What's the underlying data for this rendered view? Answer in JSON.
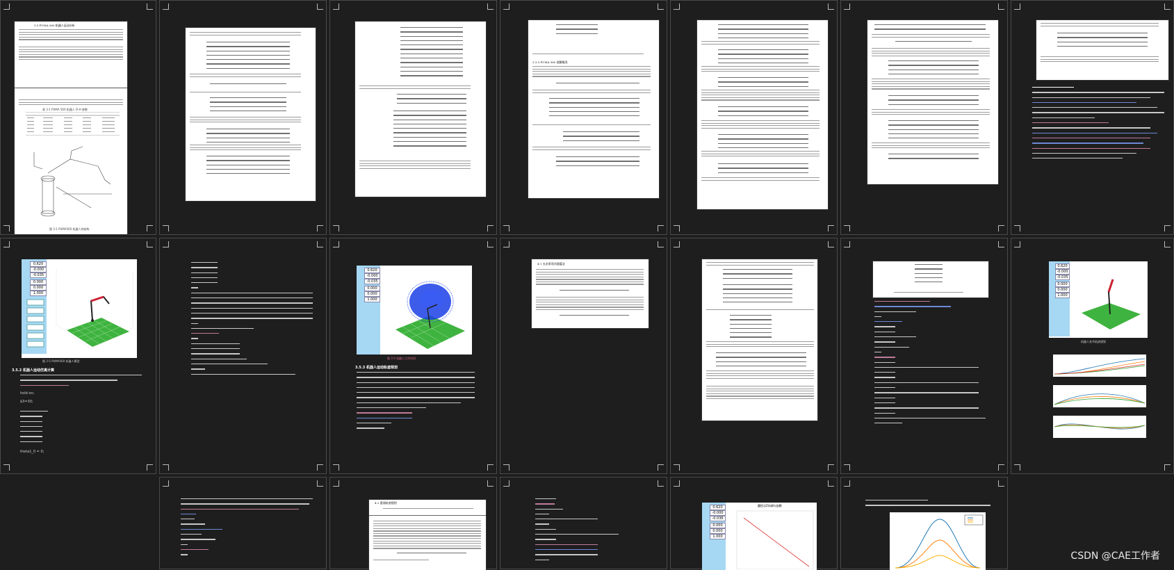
{
  "watermark": "CSDN @CAE工作者",
  "pages": {
    "p1": {
      "section": "3.3  PUMA 560 机器人运动分析",
      "table_caption": "表 3-1  PUMA 560 机器人 D-H 参数",
      "figure_caption": "图 3-1  PUMA560 机器人的结构"
    },
    "p4": {
      "section": "3.3.3  PUMA 560 逆解推导"
    },
    "p8": {
      "caption": "图 3-5 PUMA560 机器人模型",
      "section": "3.5.2 机器人运动仿真计算",
      "code": [
        "hold on;",
        "$3=30;",
        "theta1_0 = 0;"
      ]
    },
    "p10": {
      "caption": "图 3-5 机器人工作空间",
      "section": "3.5.3 机器人运动轨迹规划"
    },
    "p11": {
      "section": "4.1  五次多项式插值法"
    },
    "p14": {
      "caption": "机器人关节轨迹规划"
    },
    "p17": {
      "section": "4.2  直线轨迹规划"
    },
    "p19": {
      "chart_title": "圆柱沿Z向调与函数"
    }
  },
  "teach_panel_a": {
    "px": "0.620",
    "py": "-0.000",
    "pz": "-0.035",
    "rx": "0.000",
    "ry": "0.000",
    "rz": "1.000"
  },
  "teach_panel_b": {
    "px": "0.620",
    "py": "-0.000",
    "pz": "-0.035",
    "rx": "0.000",
    "ry": "0.000",
    "rz": "1.000"
  },
  "teach_panel_c": {
    "px": "0.620",
    "py": "-0.000",
    "pz": "-0.035",
    "rx": "0.000",
    "ry": "0.000",
    "rz": "1.000"
  },
  "teach_panel_d": {
    "px": "0.620",
    "py": "-0.000",
    "pz": "-0.036",
    "rx": "0.000",
    "ry": "0.000",
    "rz": "1.000"
  },
  "colors": {
    "background": "#1e1e1e",
    "page": "#ffffff",
    "panel": "#a6d8f4",
    "grid_green": "#3fb33f",
    "cloud_blue": "#1b3fe6"
  }
}
